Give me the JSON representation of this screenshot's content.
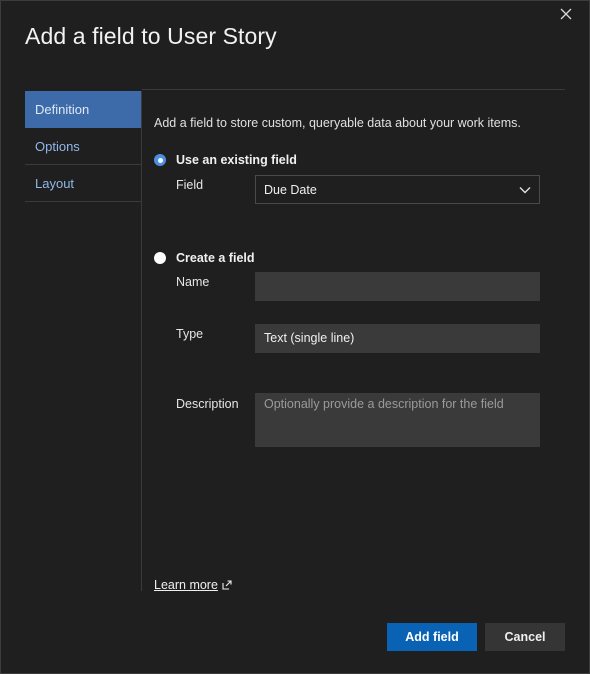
{
  "dialog": {
    "title": "Add a field to User Story",
    "close_icon": "close-icon"
  },
  "sidebar": {
    "items": [
      {
        "label": "Definition",
        "active": true
      },
      {
        "label": "Options",
        "active": false
      },
      {
        "label": "Layout",
        "active": false
      }
    ]
  },
  "definition": {
    "intro": "Add a field to store custom, queryable data about your work items.",
    "existing": {
      "radio_label": "Use an existing field",
      "checked": true,
      "field_label": "Field",
      "field_value": "Due Date"
    },
    "create": {
      "radio_label": "Create a field",
      "checked": false,
      "name_label": "Name",
      "name_value": "",
      "type_label": "Type",
      "type_value": "Text (single line)",
      "description_label": "Description",
      "description_placeholder": "Optionally provide a description for the field"
    }
  },
  "footer": {
    "learn_more": "Learn more",
    "add_label": "Add field",
    "cancel_label": "Cancel"
  },
  "colors": {
    "accent": "#0a62b5",
    "active_tab": "#3d6aa8",
    "background": "#201f1f"
  }
}
